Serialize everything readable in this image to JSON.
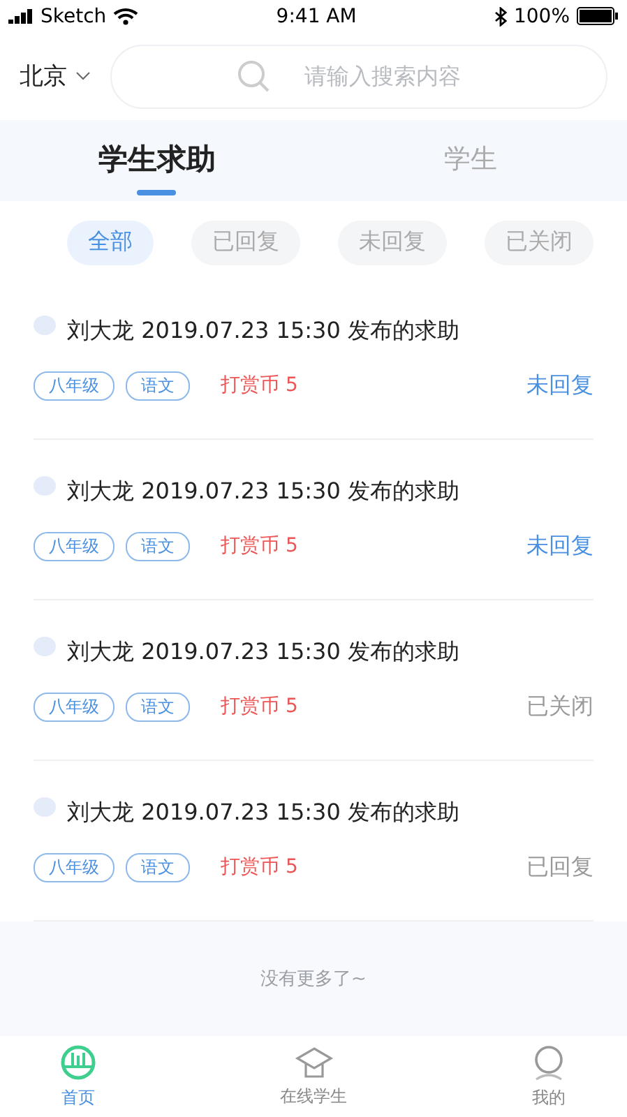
{
  "status_bar": {
    "carrier": "Sketch",
    "time": "9:41 AM",
    "battery": "100%"
  },
  "header": {
    "city": "北京",
    "search": {
      "placeholder": "请输入搜索内容"
    }
  },
  "tabs": [
    {
      "label": "学生求助",
      "selected": true
    },
    {
      "label": "学生",
      "selected": false
    }
  ],
  "filters": [
    {
      "label": "全部",
      "selected": true
    },
    {
      "label": "已回复",
      "selected": false
    },
    {
      "label": "未回复",
      "selected": false
    },
    {
      "label": "已关闭",
      "selected": false
    }
  ],
  "requests": [
    {
      "title": "刘大龙 2019.07.23 15:30 发布的求助",
      "tags": [
        "八年级",
        "语文"
      ],
      "reward": "打赏币 5",
      "status": {
        "kind": "pending",
        "label": "未回复"
      }
    },
    {
      "title": "刘大龙 2019.07.23 15:30 发布的求助",
      "tags": [
        "八年级",
        "语文"
      ],
      "reward": "打赏币 5",
      "status": {
        "kind": "pending",
        "label": "未回复"
      }
    },
    {
      "title": "刘大龙 2019.07.23 15:30 发布的求助",
      "tags": [
        "八年级",
        "语文"
      ],
      "reward": "打赏币 5",
      "status": {
        "kind": "closed",
        "label": "已关闭"
      }
    },
    {
      "title": "刘大龙 2019.07.23 15:30 发布的求助",
      "tags": [
        "八年级",
        "语文"
      ],
      "reward": "打赏币 5",
      "status": {
        "kind": "replied",
        "label": "已回复"
      }
    }
  ],
  "end_note": "没有更多了~",
  "bottom_nav": [
    {
      "label": "首页",
      "selected": true
    },
    {
      "label": "在线学生",
      "selected": false
    },
    {
      "label": "我的",
      "selected": false
    }
  ]
}
